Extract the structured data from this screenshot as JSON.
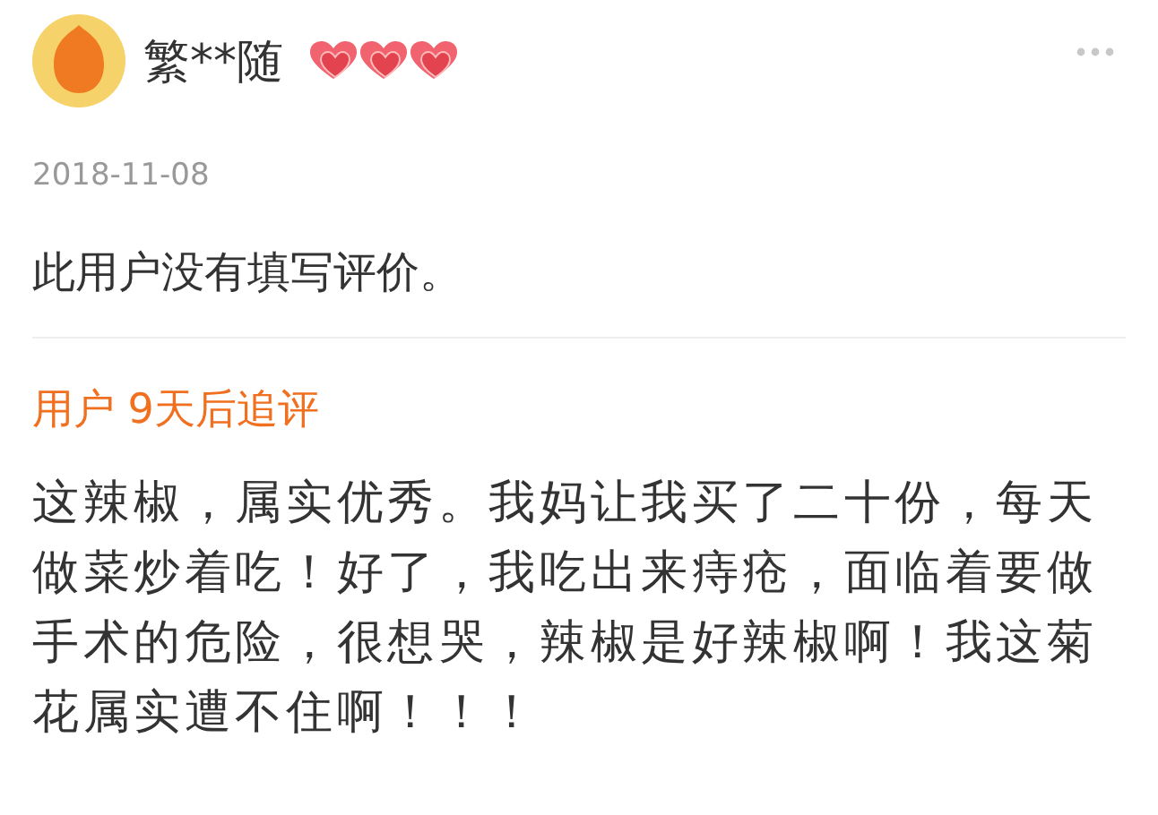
{
  "review": {
    "user": {
      "name": "繁**随",
      "stars": 3
    },
    "date": "2018-11-08",
    "text": "此用户没有填写评价。",
    "followup": {
      "label": "用户 9天后追评",
      "text": "这辣椒，属实优秀。我妈让我买了二十份，每天做菜炒着吃！好了，我吃出来痔疮，面临着要做手术的危险，很想哭，辣椒是好辣椒啊！我这菊花属实遭不住啊！！！"
    }
  }
}
